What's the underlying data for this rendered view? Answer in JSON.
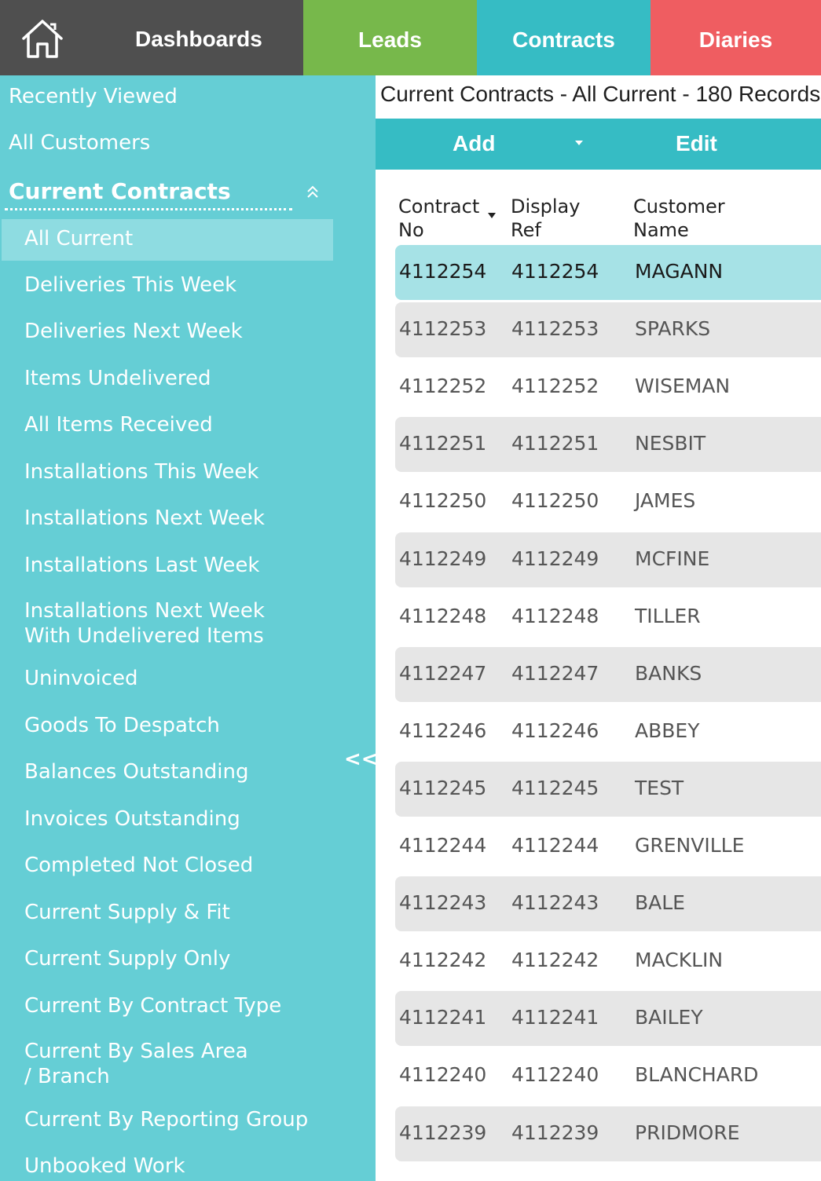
{
  "topnav": {
    "home_icon": "home-icon",
    "tabs": [
      {
        "label": "Dashboards",
        "color": "#4f4f4f"
      },
      {
        "label": "Leads",
        "color": "#77b84b"
      },
      {
        "label": "Contracts",
        "color": "#36bcc4"
      },
      {
        "label": "Diaries",
        "color": "#ef5d61"
      }
    ]
  },
  "sidebar": {
    "recently_viewed": "Recently Viewed",
    "all_customers": "All Customers",
    "section_title": "Current Contracts",
    "collapse_icon": "double-chevron-up-icon",
    "toggle_label": "<<",
    "items": [
      "All Current",
      "Deliveries This Week",
      "Deliveries Next Week",
      "Items Undelivered",
      "All Items Received",
      "Installations This Week",
      "Installations Next Week",
      "Installations Last Week",
      "Installations Next Week With Undelivered Items",
      "Uninvoiced",
      "Goods To Despatch",
      "Balances Outstanding",
      "Invoices Outstanding",
      "Completed Not Closed",
      "Current Supply & Fit",
      "Current Supply Only",
      "Current By Contract Type",
      "Current By Sales Area / Branch",
      "Current By Reporting Group",
      "Unbooked Work"
    ],
    "active_item": "All Current"
  },
  "main": {
    "title": "Current Contracts - All Current - 180 Records",
    "toolbar": {
      "add_label": "Add",
      "edit_label": "Edit"
    },
    "columns": [
      "Contract No",
      "Display Ref",
      "Customer Name"
    ],
    "rows": [
      [
        "4112254",
        "4112254",
        "MAGANN"
      ],
      [
        "4112253",
        "4112253",
        "SPARKS"
      ],
      [
        "4112252",
        "4112252",
        "WISEMAN"
      ],
      [
        "4112251",
        "4112251",
        "NESBIT"
      ],
      [
        "4112250",
        "4112250",
        "JAMES"
      ],
      [
        "4112249",
        "4112249",
        "MCFINE"
      ],
      [
        "4112248",
        "4112248",
        "TILLER"
      ],
      [
        "4112247",
        "4112247",
        "BANKS"
      ],
      [
        "4112246",
        "4112246",
        "ABBEY"
      ],
      [
        "4112245",
        "4112245",
        "TEST"
      ],
      [
        "4112244",
        "4112244",
        "GRENVILLE"
      ],
      [
        "4112243",
        "4112243",
        "BALE"
      ],
      [
        "4112242",
        "4112242",
        "MACKLIN"
      ],
      [
        "4112241",
        "4112241",
        "BAILEY"
      ],
      [
        "4112240",
        "4112240",
        "BLANCHARD"
      ],
      [
        "4112239",
        "4112239",
        "PRIDMORE"
      ]
    ],
    "selected_row": "4112254"
  }
}
